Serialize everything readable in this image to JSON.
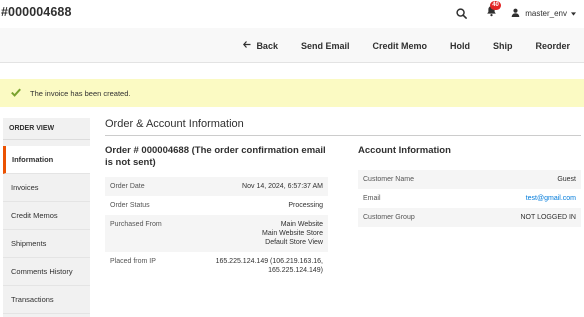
{
  "header": {
    "title": "#000004688",
    "notifications_count": "40",
    "username": "master_env"
  },
  "actions": {
    "back": "Back",
    "send_email": "Send Email",
    "credit_memo": "Credit Memo",
    "hold": "Hold",
    "ship": "Ship",
    "reorder": "Reorder"
  },
  "message": {
    "text": "The invoice has been created."
  },
  "sidebar": {
    "title": "ORDER VIEW",
    "items": [
      {
        "label": "Information"
      },
      {
        "label": "Invoices"
      },
      {
        "label": "Credit Memos"
      },
      {
        "label": "Shipments"
      },
      {
        "label": "Comments History"
      },
      {
        "label": "Transactions"
      }
    ]
  },
  "main": {
    "section_title": "Order & Account Information",
    "order": {
      "heading": "Order # 000004688 (The order confirmation email is not sent)",
      "rows": [
        {
          "label": "Order Date",
          "value": "Nov 14, 2024, 6:57:37 AM"
        },
        {
          "label": "Order Status",
          "value": "Processing"
        },
        {
          "label": "Purchased From",
          "value_lines": [
            "Main Website",
            "Main Website Store",
            "Default Store View"
          ]
        },
        {
          "label": "Placed from IP",
          "value_lines": [
            "165.225.124.149 (106.219.163.16,",
            "165.225.124.149)"
          ]
        }
      ]
    },
    "account": {
      "heading": "Account Information",
      "rows": [
        {
          "label": "Customer Name",
          "value": "Guest"
        },
        {
          "label": "Email",
          "value": "test@gmail.com"
        },
        {
          "label": "Customer Group",
          "value": "NOT LOGGED IN"
        }
      ]
    }
  },
  "colors": {
    "accent": "#eb5202",
    "message_bg": "#fbfac3",
    "check": "#79a22e",
    "link": "#007bdb",
    "badge": "#e22626"
  },
  "icons": [
    "search-icon",
    "bell-icon",
    "user-icon",
    "chevron-down-icon",
    "arrow-left-icon",
    "check-icon"
  ]
}
